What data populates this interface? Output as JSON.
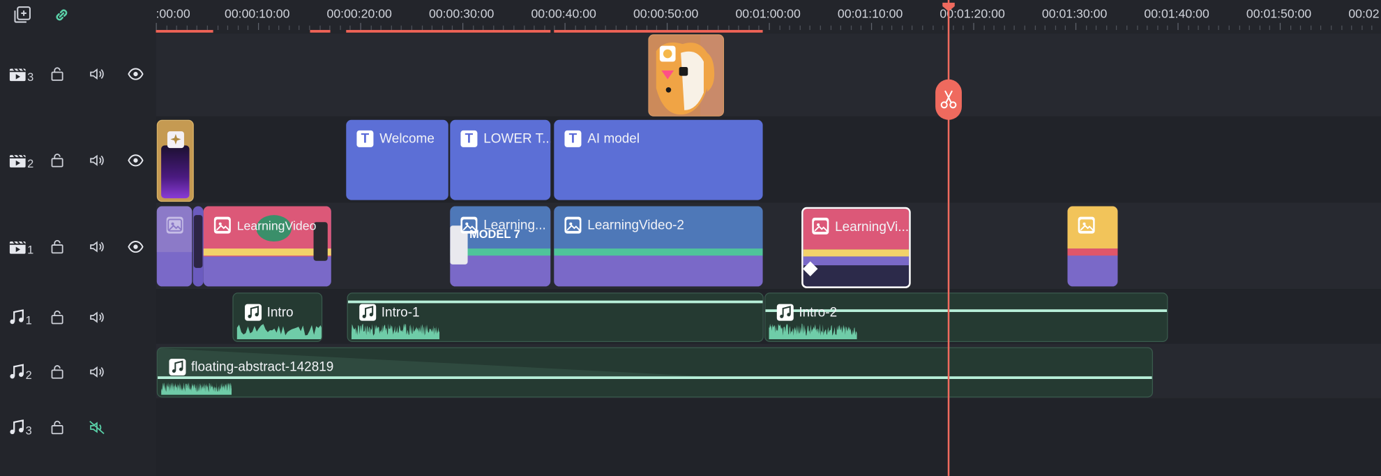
{
  "toolbar": {
    "icons": [
      "add-track-icon",
      "link-icon"
    ]
  },
  "ruler": {
    "labels": [
      ":00:00",
      "00:00:10:00",
      "00:00:20:00",
      "00:00:30:00",
      "00:00:40:00",
      "00:00:50:00",
      "00:01:00:00",
      "00:01:10:00",
      "00:01:20:00",
      "00:01:30:00",
      "00:01:40:00",
      "00:01:50:00",
      "00:02"
    ]
  },
  "tracks": [
    {
      "kind": "video",
      "number": "3",
      "muted": false,
      "visible": true
    },
    {
      "kind": "video",
      "number": "2",
      "muted": false,
      "visible": true
    },
    {
      "kind": "video",
      "number": "1",
      "muted": false,
      "visible": true
    },
    {
      "kind": "audio",
      "number": "1",
      "muted": false
    },
    {
      "kind": "audio",
      "number": "2",
      "muted": false
    },
    {
      "kind": "audio",
      "number": "3",
      "muted": true
    }
  ],
  "clips": {
    "text_welcome": "Welcome",
    "text_lower": "LOWER T...",
    "text_ai": "AI model",
    "video_learning_1": "LearningVideo",
    "video_learning_2": "Learning...",
    "video_learning_3": "LearningVideo-2",
    "video_learning_4": "LearningVi...",
    "video_learning_2_overlay": "MODEL 7",
    "audio_intro": "Intro",
    "audio_intro_1": "Intro-1",
    "audio_intro_2": "Intro-2",
    "audio_floating": "floating-abstract-142819"
  },
  "playhead": {
    "time": "00:01:17:00"
  },
  "colors": {
    "accent": "#ef6a5e",
    "title_clip": "#5c6fd6",
    "audio_clip": "#253a32",
    "audio_wave": "#6fcca8",
    "mute_active": "#5ad1a8"
  }
}
